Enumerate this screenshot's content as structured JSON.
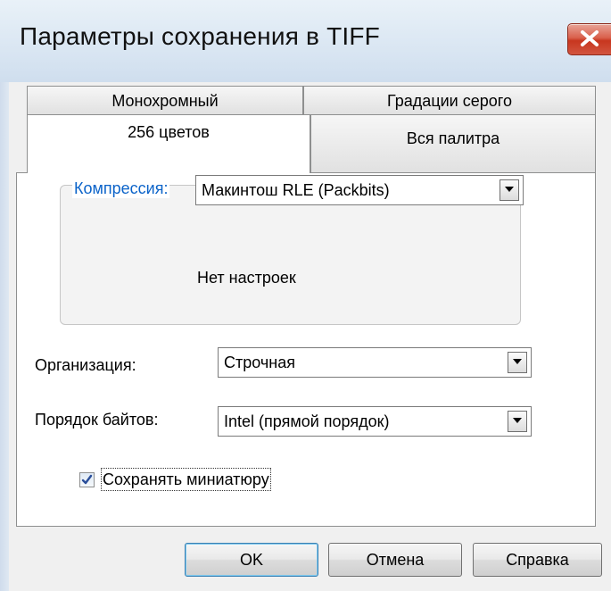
{
  "window": {
    "title": "Параметры сохранения в TIFF"
  },
  "tabs": {
    "row_back": [
      "Монохромный",
      "Градации серого"
    ],
    "row_front": [
      "256 цветов",
      "Вся палитра"
    ],
    "active": "256 цветов"
  },
  "compression": {
    "label": "Компрессия:",
    "value": "Макинтош RLE (Packbits)",
    "info": "Нет настроек"
  },
  "organization": {
    "label": "Организация:",
    "value": "Строчная"
  },
  "byte_order": {
    "label": "Порядок байтов:",
    "value": "Intel (прямой порядок)"
  },
  "thumbnail": {
    "label": "Сохранять миниатюру",
    "checked": true
  },
  "buttons": {
    "ok": "OK",
    "cancel": "Отмена",
    "help": "Справка"
  },
  "colors": {
    "group_label": "#0b63c9",
    "close_button": "#c8361f"
  }
}
